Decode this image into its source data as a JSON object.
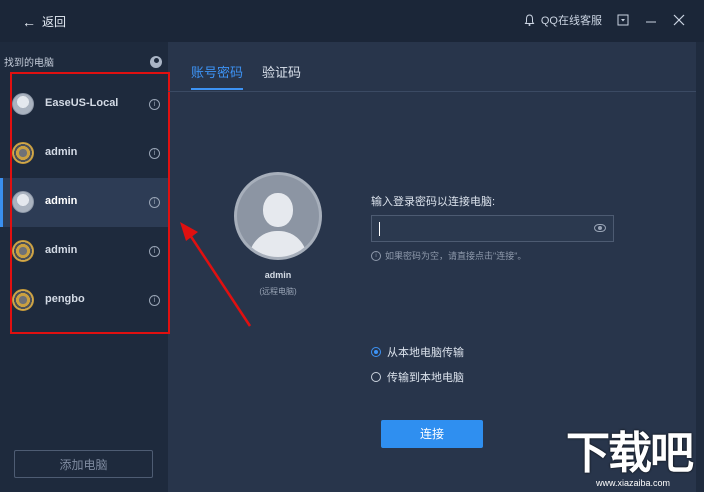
{
  "titlebar": {
    "back_label": "返回",
    "back_icon": "arrow-left-icon",
    "support_label": "QQ在线客服",
    "support_icon": "bell-icon"
  },
  "sidebar": {
    "header": "找到的电脑",
    "devices": [
      {
        "name": "EaseUS-Local",
        "avatar": "gray",
        "selected": false
      },
      {
        "name": "admin",
        "avatar": "gold",
        "selected": false
      },
      {
        "name": "admin",
        "avatar": "gray",
        "selected": true
      },
      {
        "name": "admin",
        "avatar": "gold",
        "selected": false
      },
      {
        "name": "pengbo",
        "avatar": "gold",
        "selected": false
      }
    ],
    "add_button": "添加电脑"
  },
  "main": {
    "tabs": [
      {
        "label": "账号密码",
        "active": true
      },
      {
        "label": "验证码",
        "active": false
      }
    ],
    "remote": {
      "name": "admin",
      "subtitle": "(远程电脑)"
    },
    "password_label": "输入登录密码以连接电脑:",
    "password_value": "",
    "hint": "如果密码为空，请直接点击\"连接\"。",
    "transfer_options": [
      {
        "label": "从本地电脑传输",
        "checked": true
      },
      {
        "label": "传输到本地电脑",
        "checked": false
      }
    ],
    "connect_button": "连接"
  },
  "watermark": {
    "text": "下载吧",
    "url": "www.xiazaiba.com"
  },
  "colors": {
    "accent": "#2f8ff0",
    "annotation": "#e01010",
    "background": "#28354b",
    "sidebar": "#1e2a3d"
  }
}
